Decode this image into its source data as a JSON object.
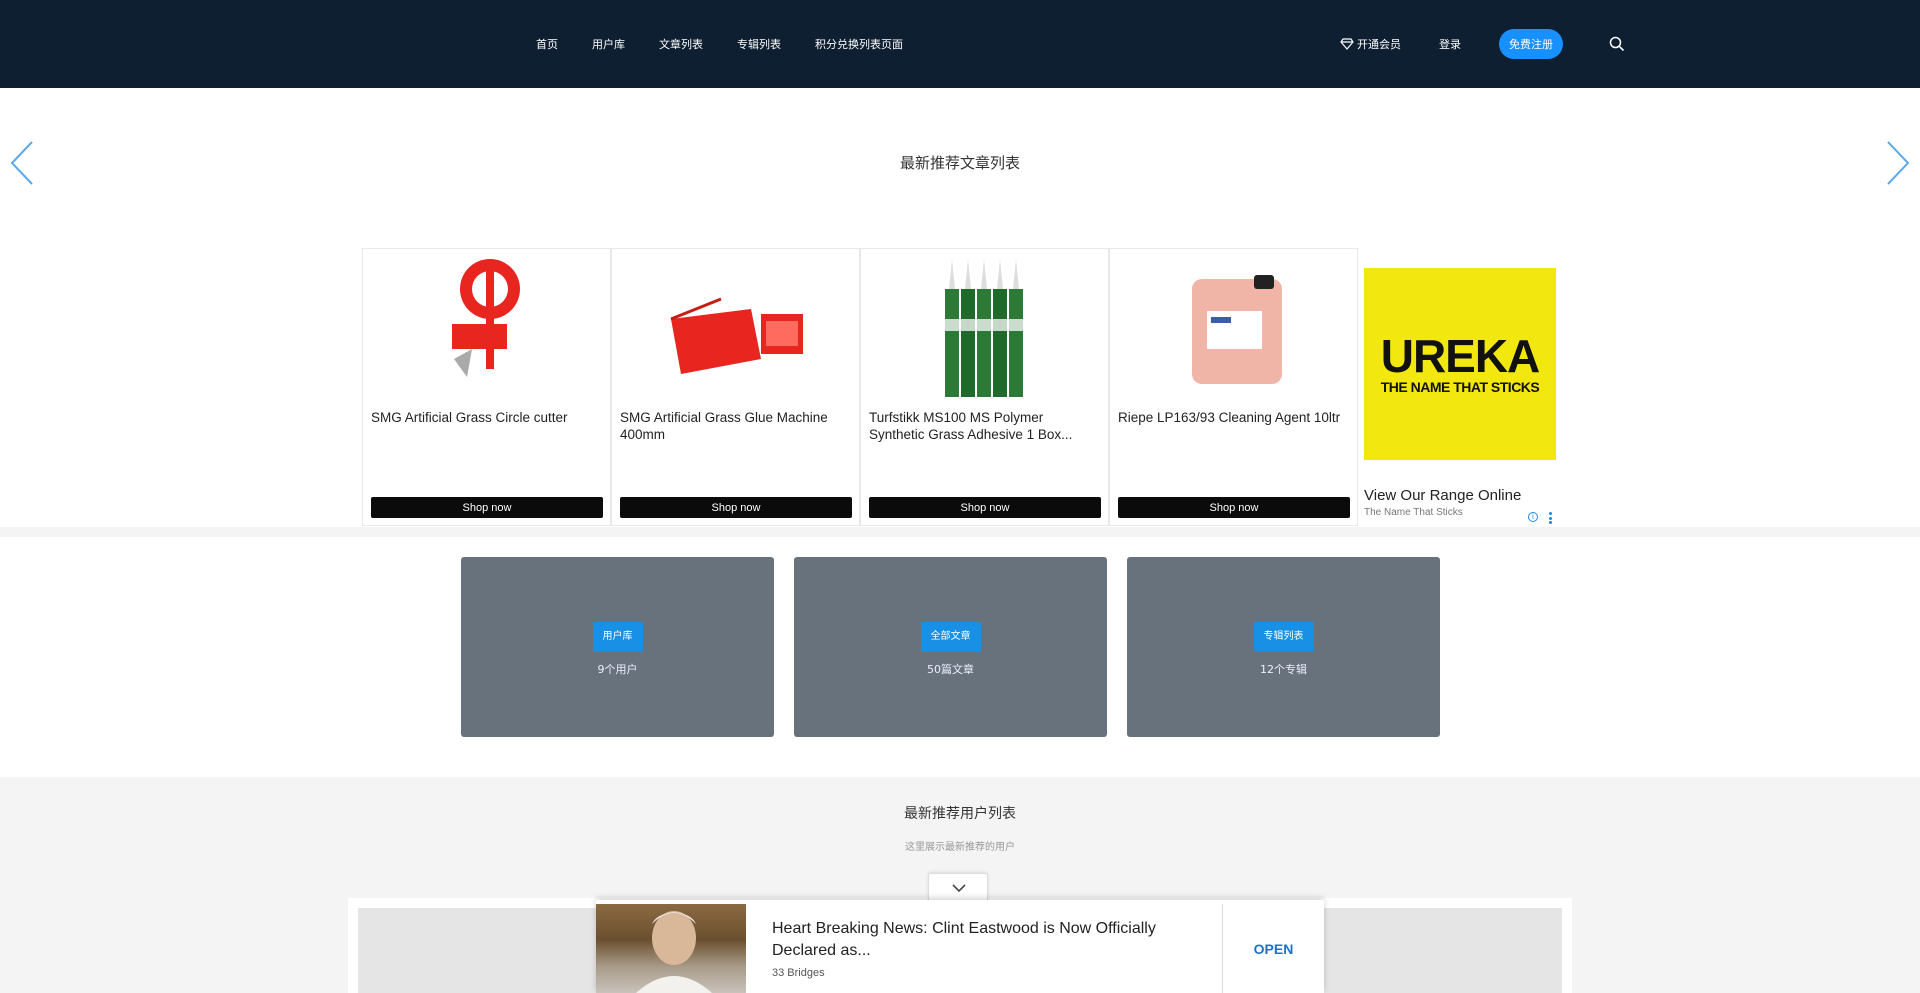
{
  "header": {
    "nav": [
      "首页",
      "用户库",
      "文章列表",
      "专辑列表",
      "积分兑换列表页面"
    ],
    "vip_label": "开通会员",
    "login_label": "登录",
    "register_label": "免费注册"
  },
  "ads": {
    "section_title": "最新推荐文章列表",
    "products": [
      {
        "title": "SMG Artificial Grass Circle cutter",
        "cta": "Shop now"
      },
      {
        "title": "SMG Artificial Grass Glue Machine 400mm",
        "cta": "Shop now"
      },
      {
        "title": "Turfstikk MS100 MS Polymer Synthetic Grass Adhesive 1 Box...",
        "cta": "Shop now"
      },
      {
        "title": "Riepe LP163/93 Cleaning Agent 10ltr",
        "cta": "Shop now"
      }
    ],
    "display_ad": {
      "brand": "UREKA",
      "tagline": "THE NAME THAT STICKS",
      "headline": "View Our Range Online",
      "sub": "The Name That Sticks",
      "brand_color": "#f2e70f"
    }
  },
  "categories": [
    {
      "label": "用户库",
      "count": "9个用户"
    },
    {
      "label": "全部文章",
      "count": "50篇文章"
    },
    {
      "label": "专辑列表",
      "count": "12个专辑"
    }
  ],
  "bottom": {
    "title": "最新推荐用户列表",
    "subtitle": "这里展示最新推荐的用户"
  },
  "sticky_ad": {
    "headline": "Heart Breaking News: Clint Eastwood is Now Officially Declared as...",
    "source": "33 Bridges",
    "cta": "OPEN",
    "cta_color": "#1a73c8"
  },
  "colors": {
    "header_bg": "#0e1f31",
    "accent": "#1890ff",
    "card_bg": "#68727d"
  }
}
